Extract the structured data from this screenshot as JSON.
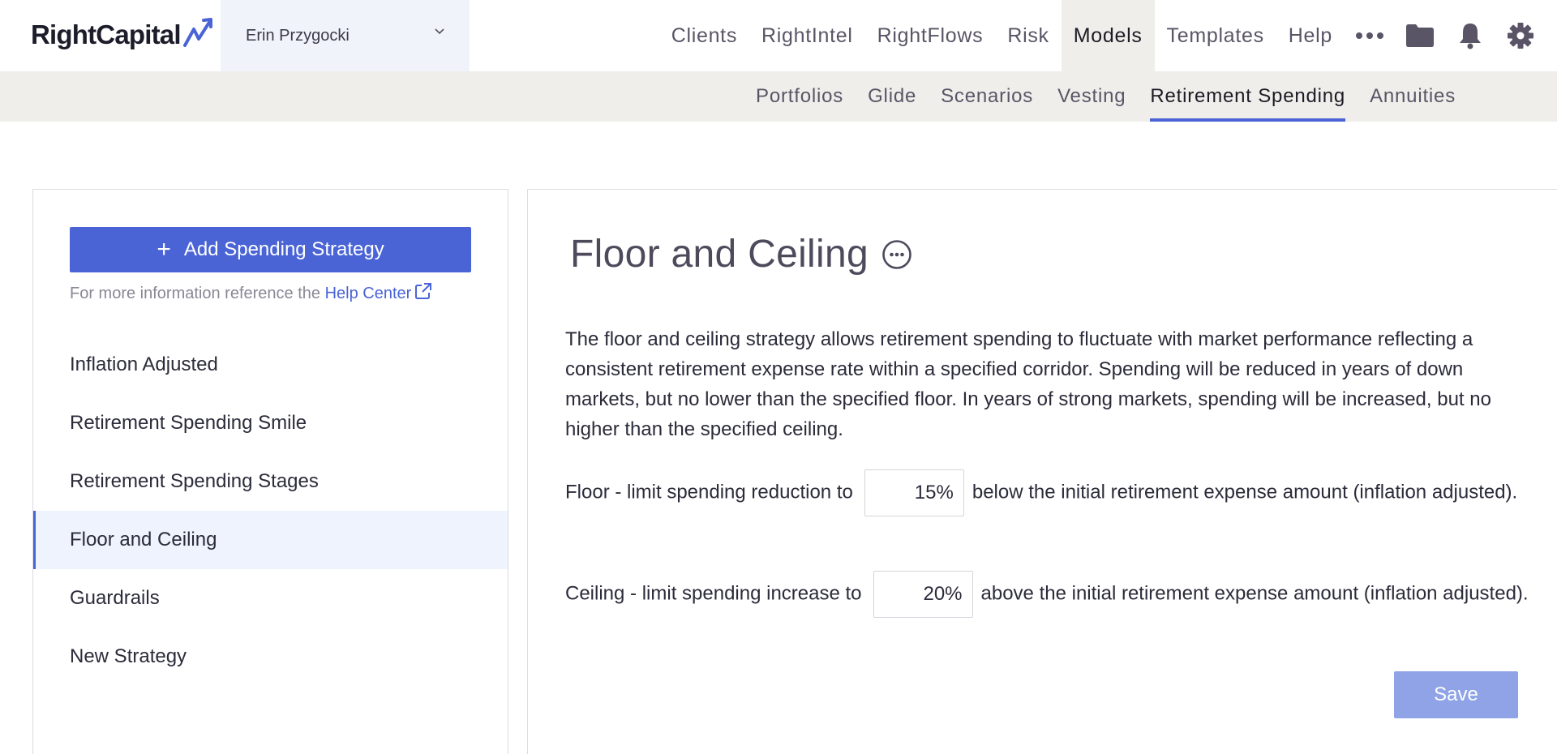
{
  "brand": {
    "name": "RightCapital",
    "accent": "#4a64d6"
  },
  "client": {
    "name": "Erin Przygocki"
  },
  "main_nav": [
    {
      "label": "Clients"
    },
    {
      "label": "RightIntel"
    },
    {
      "label": "RightFlows"
    },
    {
      "label": "Risk"
    },
    {
      "label": "Models",
      "active": true
    },
    {
      "label": "Templates"
    },
    {
      "label": "Help"
    }
  ],
  "nav_icons": [
    "more-icon",
    "folder-icon",
    "bell-icon",
    "gear-icon"
  ],
  "sub_nav": [
    {
      "label": "Portfolios"
    },
    {
      "label": "Glide"
    },
    {
      "label": "Scenarios"
    },
    {
      "label": "Vesting"
    },
    {
      "label": "Retirement Spending",
      "active": true
    },
    {
      "label": "Annuities"
    }
  ],
  "sidebar": {
    "add_button": "Add Spending Strategy",
    "help_prefix": "For more information reference the ",
    "help_link": "Help Center",
    "strategies": [
      {
        "label": "Inflation Adjusted"
      },
      {
        "label": "Retirement Spending Smile"
      },
      {
        "label": "Retirement Spending Stages"
      },
      {
        "label": "Floor and Ceiling",
        "active": true
      },
      {
        "label": "Guardrails"
      },
      {
        "label": "New Strategy"
      }
    ]
  },
  "main": {
    "title": "Floor and Ceiling",
    "description": "The floor and ceiling strategy allows retirement spending to fluctuate with market performance reflecting a consistent retirement expense rate within a specified corridor. Spending will be reduced in years of down markets, but no lower than the specified floor. In years of strong markets, spending will be increased, but no higher than the specified ceiling.",
    "floor": {
      "prefix": "Floor - limit spending reduction to",
      "value": "15%",
      "suffix": "below the initial retirement expense amount (inflation adjusted)."
    },
    "ceiling": {
      "prefix": "Ceiling - limit spending increase to",
      "value": "20%",
      "suffix": "above the initial retirement expense amount (inflation adjusted)."
    },
    "save_label": "Save"
  }
}
